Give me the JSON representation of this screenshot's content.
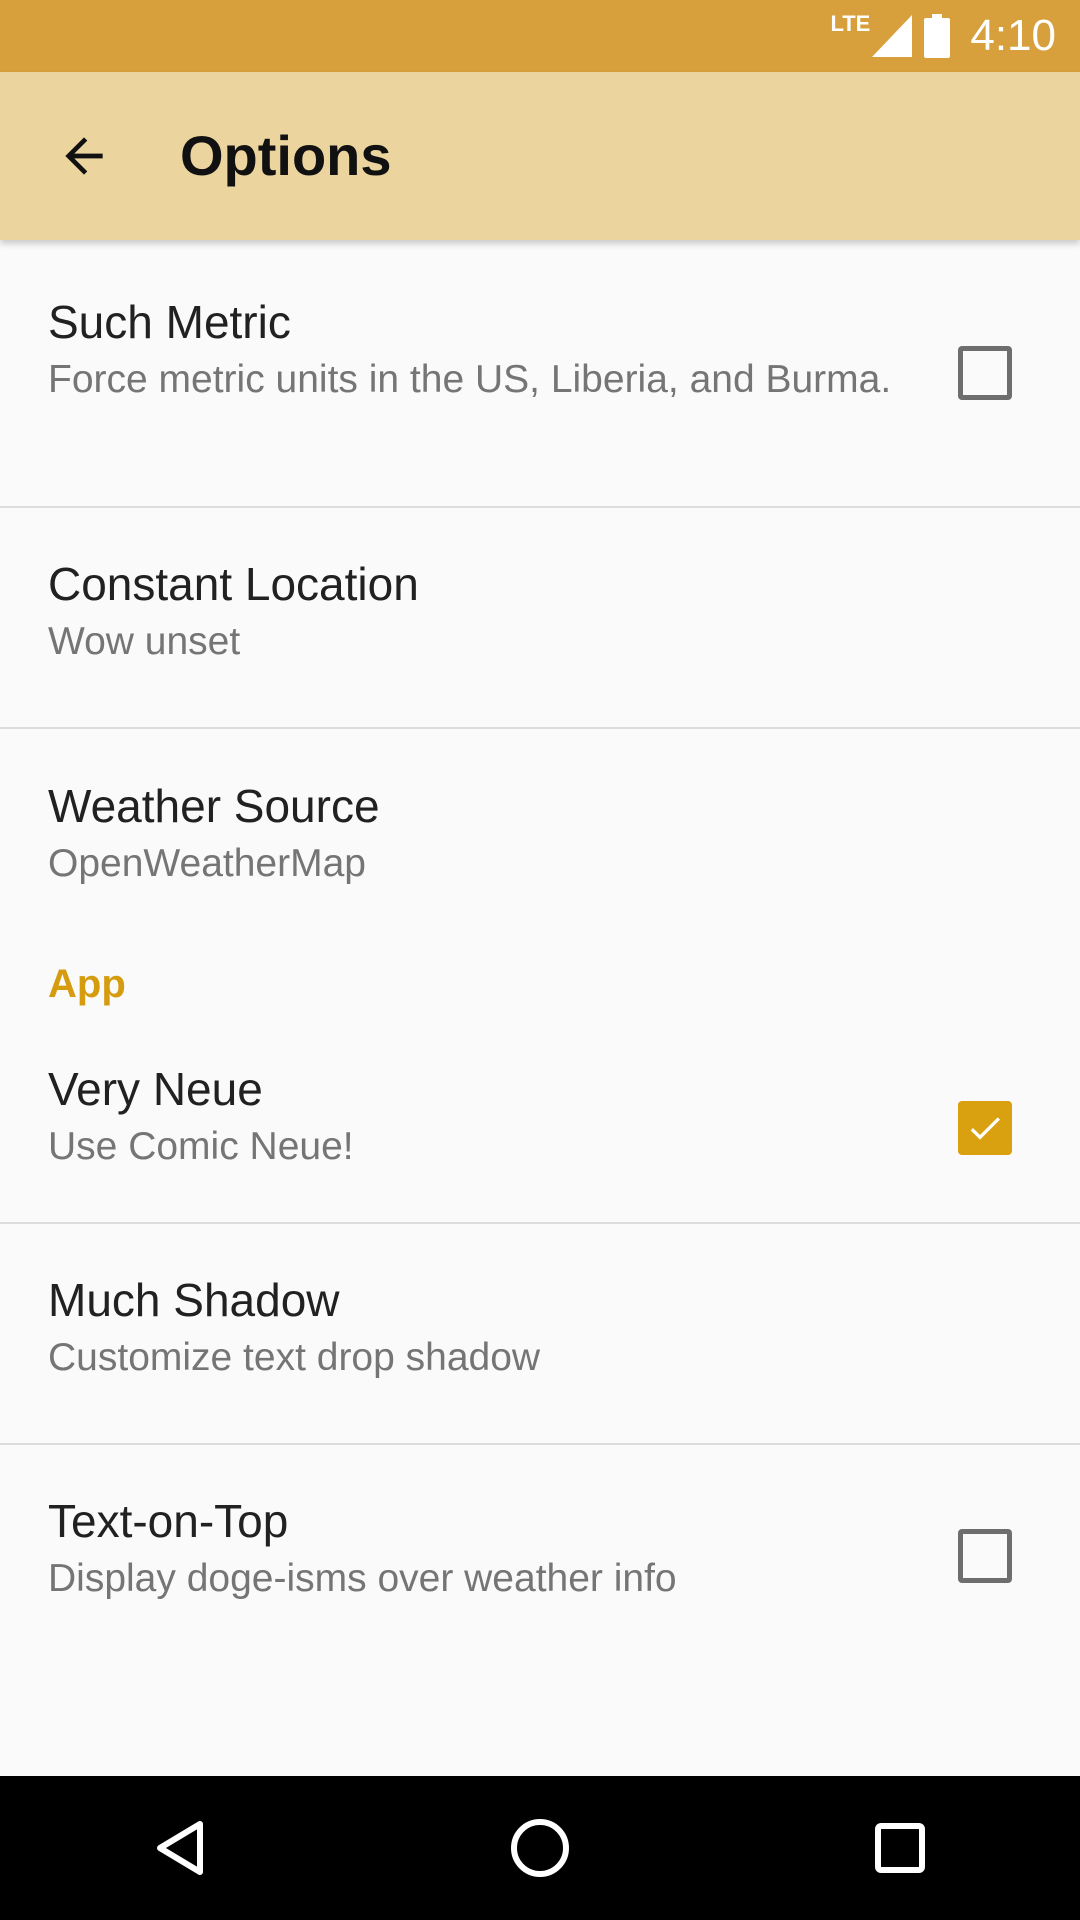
{
  "status_bar": {
    "network": "LTE",
    "time": "4:10",
    "icons": [
      "lte-signal-icon",
      "battery-icon"
    ],
    "battery_level": 1.0
  },
  "app_bar": {
    "title": "Options",
    "back_icon": "arrow-back-icon"
  },
  "preferences": [
    {
      "title": "Such Metric",
      "summary": "Force metric units in the US, Liberia, and Burma.",
      "checkbox": true,
      "checked": false
    },
    {
      "title": "Constant Location",
      "summary": "Wow unset",
      "checkbox": false
    },
    {
      "title": "Weather Source",
      "summary": "OpenWeatherMap",
      "checkbox": false
    }
  ],
  "app_section": {
    "category": "App",
    "items": [
      {
        "title": "Very Neue",
        "summary": "Use Comic Neue!",
        "checkbox": true,
        "checked": true
      },
      {
        "title": "Much Shadow",
        "summary": "Customize text drop shadow",
        "checkbox": false
      },
      {
        "title": "Text-on-Top",
        "summary": "Display doge-isms over weather info",
        "checkbox": true,
        "checked": false
      }
    ]
  },
  "nav_bar": {
    "icons": [
      "back-triangle-icon",
      "home-circle-icon",
      "recents-square-icon"
    ]
  },
  "colors": {
    "status_bar": "#d8a03c",
    "app_bar": "#ebd49e",
    "accent": "#d9a00f",
    "background": "#fafafa"
  }
}
